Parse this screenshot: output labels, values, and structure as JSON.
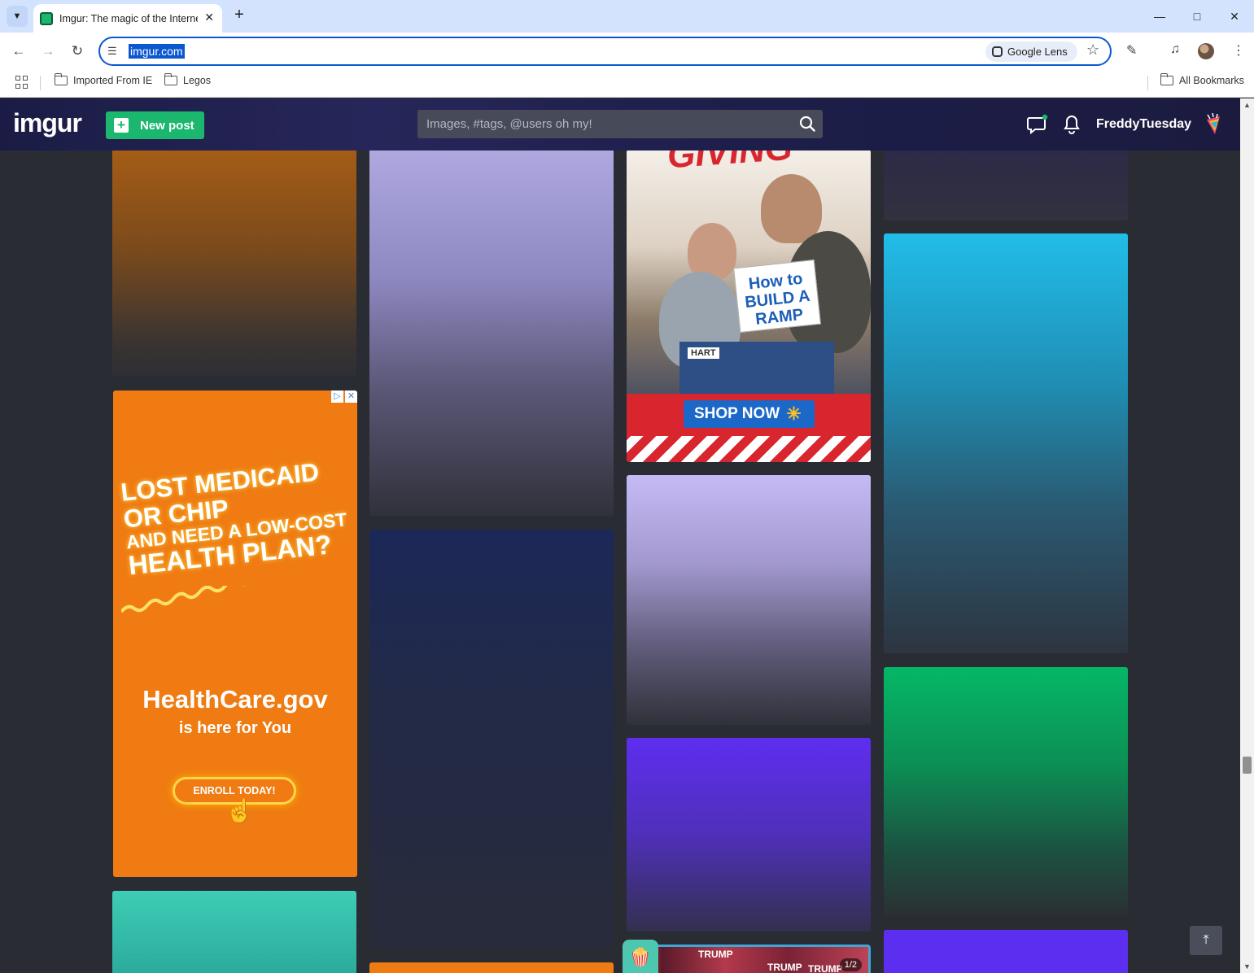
{
  "browser": {
    "tab_title": "Imgur: The magic of the Internet",
    "url": "imgur.com",
    "lens_label": "Google Lens",
    "bookmarks": [
      "Imported From IE",
      "Legos"
    ],
    "all_bookmarks": "All Bookmarks"
  },
  "header": {
    "logo": "imgur",
    "new_post": "New post",
    "search_placeholder": "Images, #tags, @users oh my!",
    "username": "FreddyTuesday"
  },
  "ads": {
    "health": {
      "line1": "LOST MEDICAID",
      "line2": "OR CHIP",
      "line3": "AND NEED A LOW-COST",
      "line4": "HEALTH PLAN?",
      "brand": "HealthCare.gov",
      "tagline": "is here for You",
      "cta": "ENROLL TODAY!"
    },
    "walmart": {
      "headline": "GIVING",
      "book": "How to BUILD A RAMP",
      "box_brand": "HART",
      "cta": "SHOP NOW"
    }
  },
  "popcorn": {
    "page_count": "1/2",
    "text": "TRUMP"
  },
  "colors": {
    "brand_green": "#1bb76e",
    "header_bg": "#1b1c45",
    "page_bg": "#2a2c33"
  }
}
